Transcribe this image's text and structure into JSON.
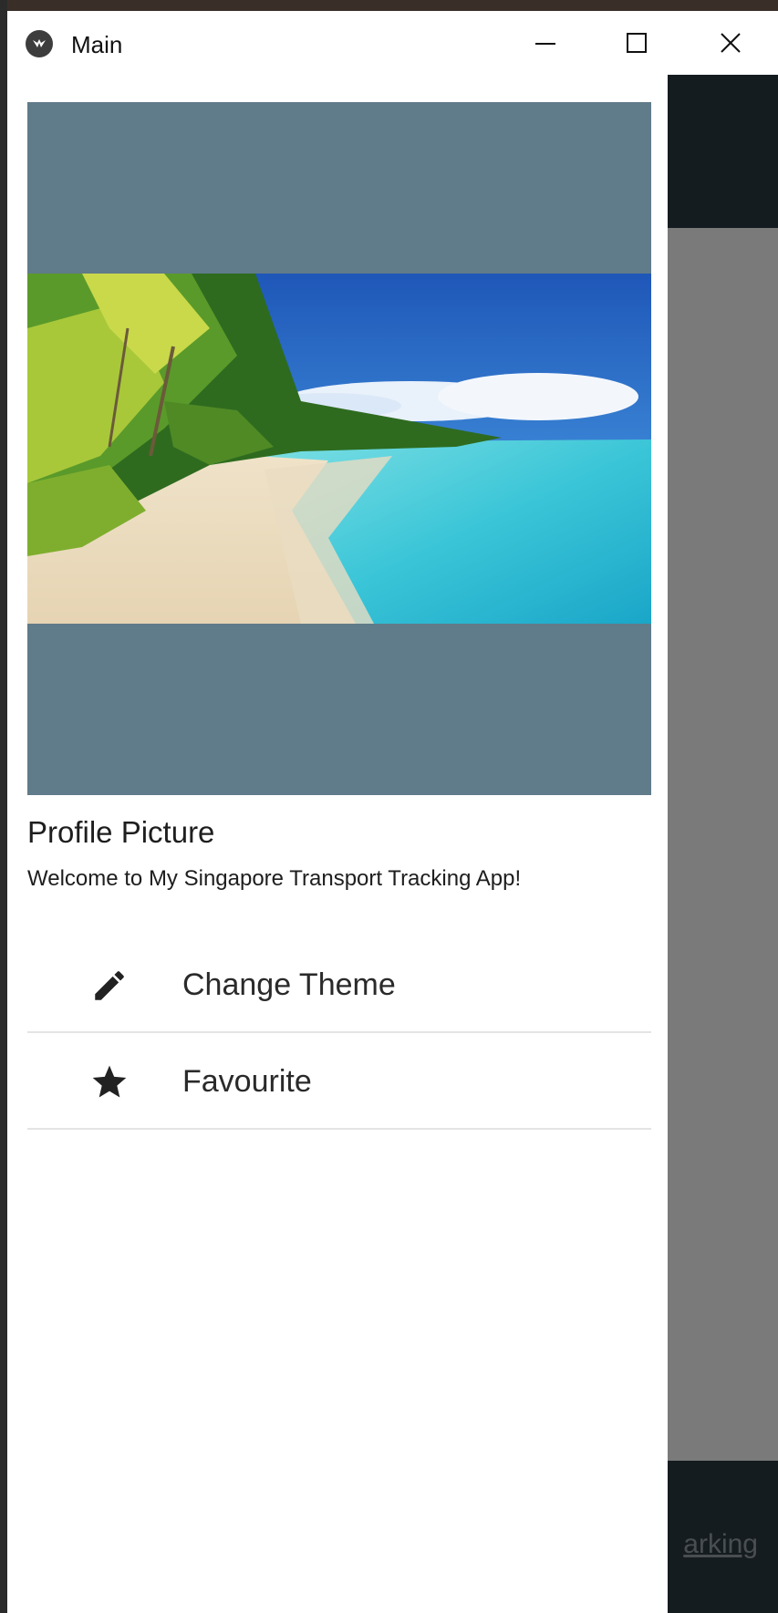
{
  "window": {
    "title": "Main",
    "minimize_label": "Minimize",
    "maximize_label": "Maximize",
    "close_label": "Close"
  },
  "drawer": {
    "header_title": "Profile Picture",
    "welcome_text": "Welcome to My Singapore Transport Tracking App!",
    "items": [
      {
        "label": "Change Theme",
        "icon": "pencil-icon"
      },
      {
        "label": "Favourite",
        "icon": "star-icon"
      }
    ]
  },
  "background_app": {
    "bottom_tab_partial_label": "arking"
  },
  "colors": {
    "header_background": "#607b89",
    "app_bar": "#2d3b44",
    "scrim": "rgba(0,0,0,0.52)",
    "divider": "#e4e4e4"
  }
}
